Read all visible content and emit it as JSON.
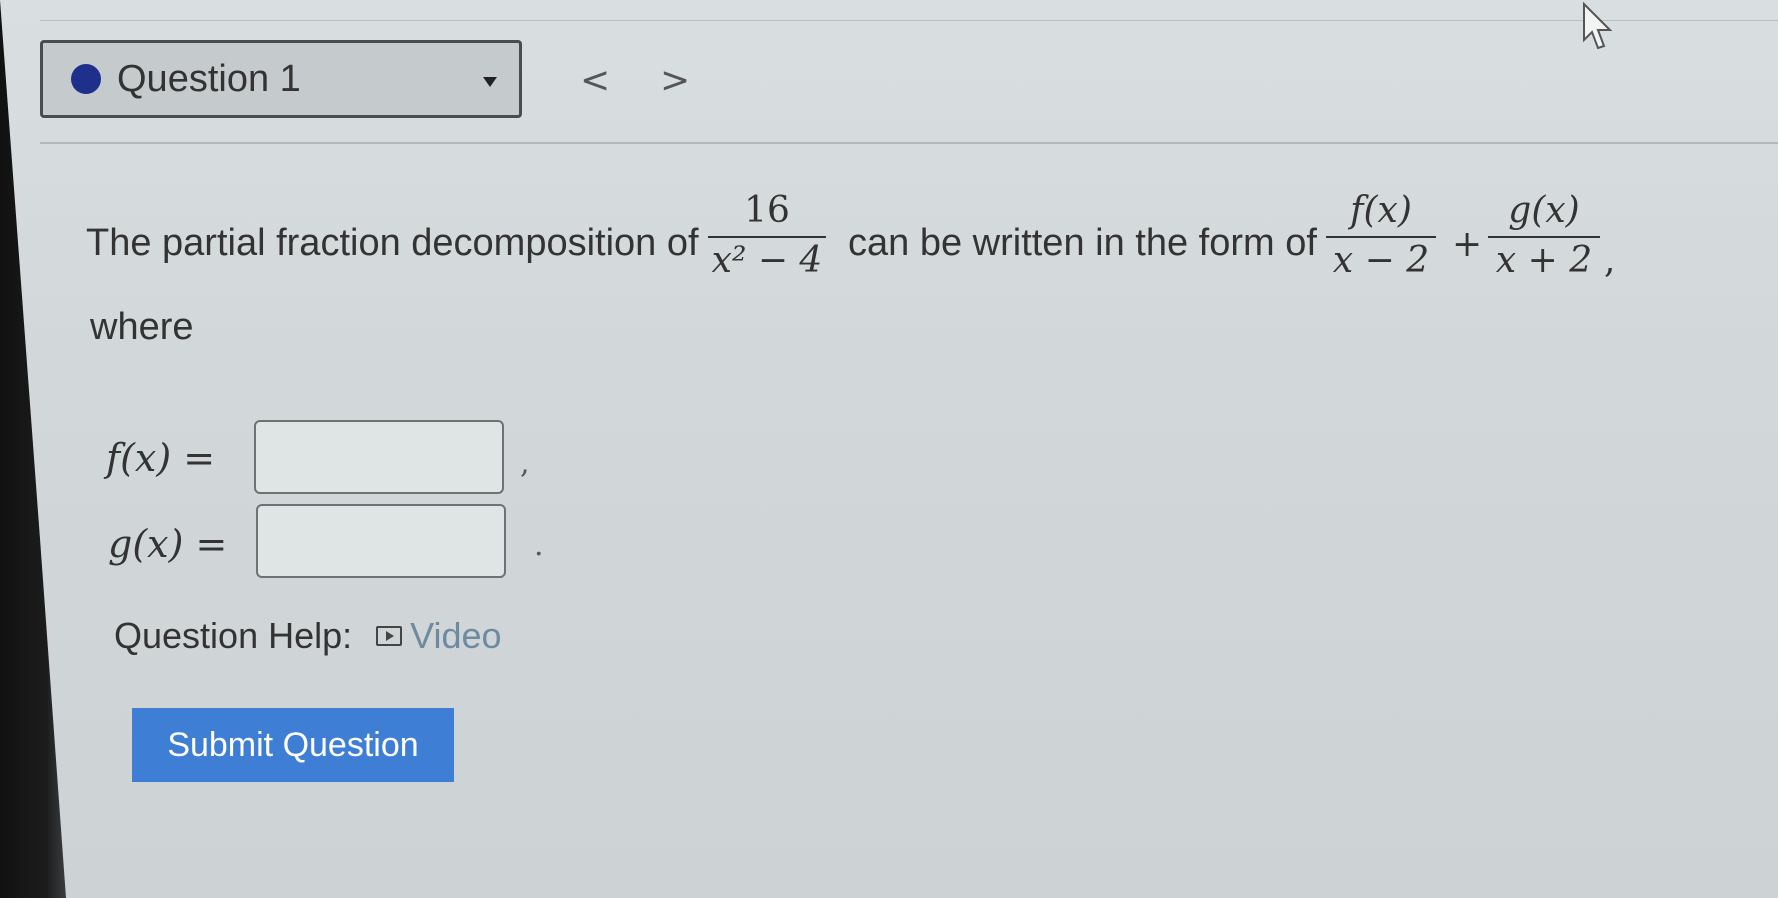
{
  "nav": {
    "question_label": "Question 1",
    "prev": "<",
    "next": ">"
  },
  "problem": {
    "lead_text": "The partial fraction decomposition of",
    "given_fraction": {
      "numerator": "16",
      "denominator": "x² − 4"
    },
    "middle_text": "can be written in the form of",
    "form_term1": {
      "numerator": "f(x)",
      "denominator": "x − 2"
    },
    "plus": "+",
    "form_term2": {
      "numerator": "g(x)",
      "denominator": "x + 2"
    },
    "trailing_comma": ",",
    "where_text": "where"
  },
  "answers": {
    "f_label": "f(x) =",
    "f_value": "",
    "f_punct": ",",
    "g_label": "g(x) =",
    "g_value": "",
    "g_punct": "."
  },
  "help": {
    "label": "Question Help:",
    "video_label": "Video"
  },
  "submit": {
    "label": "Submit Question"
  },
  "colors": {
    "status_dot": "#1f2f8c",
    "submit_bg": "#3e7ed4",
    "video_link": "#6f8aa0"
  }
}
